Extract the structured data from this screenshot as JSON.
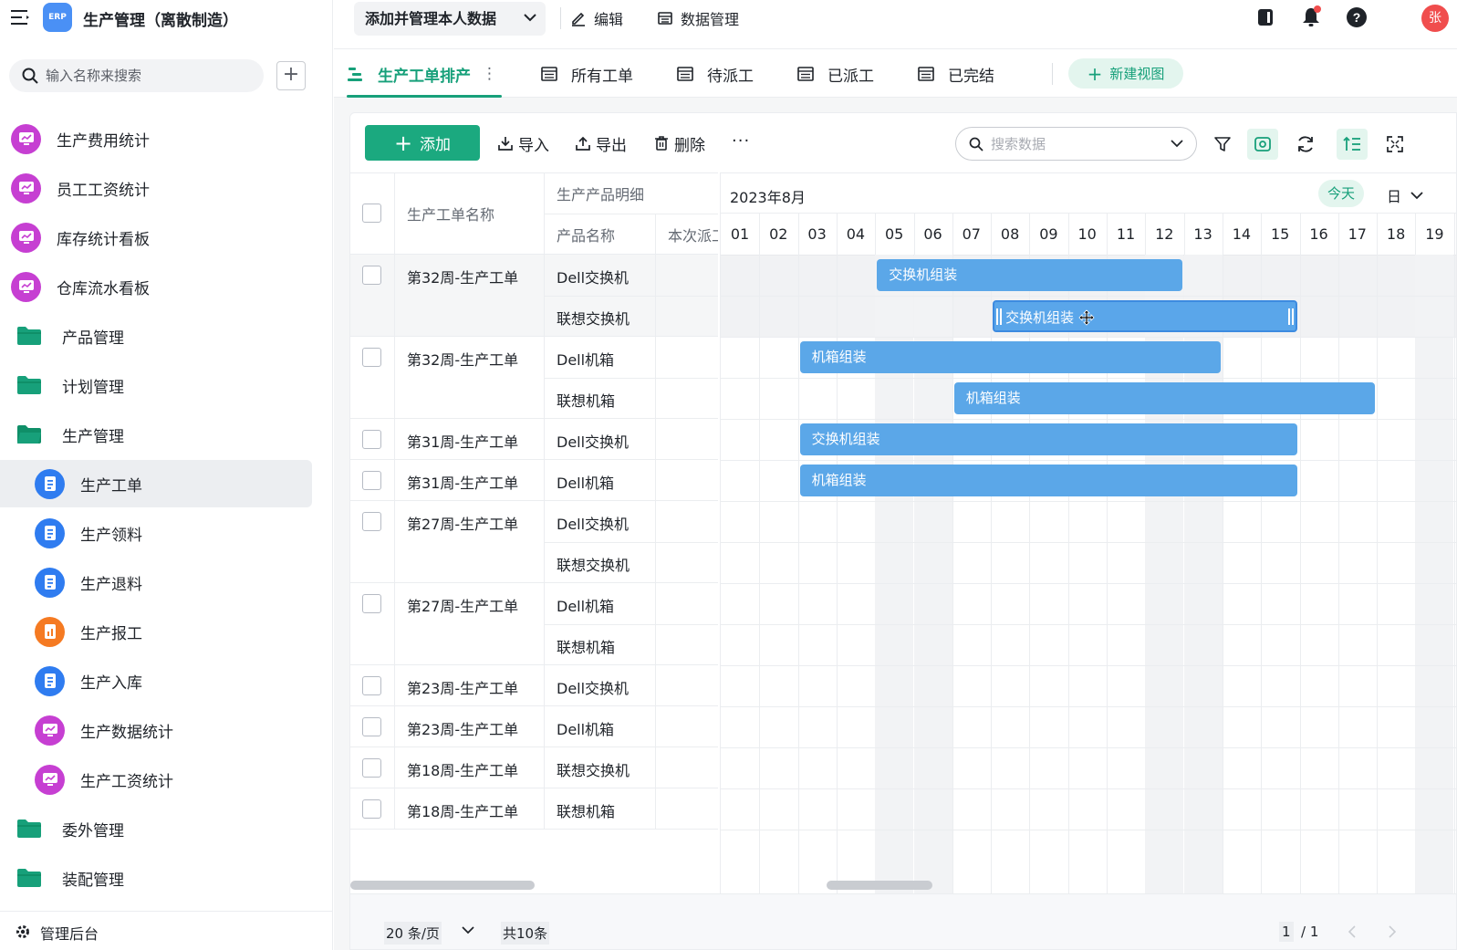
{
  "app": {
    "title": "生产管理（离散制造）",
    "logo_text": "ERP"
  },
  "sidebar": {
    "search_placeholder": "输入名称来搜索",
    "items": [
      {
        "label": "生产费用统计",
        "icon": "dashboard-icon",
        "level": 1
      },
      {
        "label": "员工工资统计",
        "icon": "dashboard-icon",
        "level": 1
      },
      {
        "label": "库存统计看板",
        "icon": "dashboard-icon",
        "level": 1
      },
      {
        "label": "仓库流水看板",
        "icon": "dashboard-icon",
        "level": 1
      },
      {
        "label": "产品管理",
        "icon": "folder-icon",
        "level": 1
      },
      {
        "label": "计划管理",
        "icon": "folder-icon",
        "level": 1
      },
      {
        "label": "生产管理",
        "icon": "folder-open-icon",
        "level": 1
      },
      {
        "label": "生产工单",
        "icon": "form-icon",
        "level": 2,
        "active": true
      },
      {
        "label": "生产领料",
        "icon": "form-icon",
        "level": 2
      },
      {
        "label": "生产退料",
        "icon": "form-icon",
        "level": 2
      },
      {
        "label": "生产报工",
        "icon": "report-icon",
        "level": 2
      },
      {
        "label": "生产入库",
        "icon": "form-icon",
        "level": 2
      },
      {
        "label": "生产数据统计",
        "icon": "dashboard-icon",
        "level": 2
      },
      {
        "label": "生产工资统计",
        "icon": "dashboard-icon",
        "level": 2
      },
      {
        "label": "委外管理",
        "icon": "folder-icon",
        "level": 1
      },
      {
        "label": "装配管理",
        "icon": "folder-icon",
        "level": 1
      }
    ],
    "footer_label": "管理后台"
  },
  "topbar": {
    "data_select": "添加并管理本人数据",
    "edit": "编辑",
    "data_manage": "数据管理",
    "avatar": "张"
  },
  "tabs": {
    "items": [
      "生产工单排产",
      "所有工单",
      "待派工",
      "已派工",
      "已完结"
    ],
    "active": 0,
    "new_view": "新建视图"
  },
  "toolbar": {
    "add": "添加",
    "import": "导入",
    "export": "导出",
    "delete": "删除",
    "more": "···",
    "search_placeholder": "搜索数据"
  },
  "table": {
    "columns": {
      "name": "生产工单名称",
      "detail_group": "生产产品明细",
      "product": "产品名称",
      "dispatch": "本次派工"
    },
    "rows": [
      {
        "name": "第32周-生产工单",
        "products": [
          "Dell交换机",
          "联想交换机"
        ]
      },
      {
        "name": "第32周-生产工单",
        "products": [
          "Dell机箱",
          "联想机箱"
        ]
      },
      {
        "name": "第31周-生产工单",
        "products": [
          "Dell交换机"
        ]
      },
      {
        "name": "第31周-生产工单",
        "products": [
          "Dell机箱"
        ]
      },
      {
        "name": "第27周-生产工单",
        "products": [
          "Dell交换机",
          "联想交换机"
        ]
      },
      {
        "name": "第27周-生产工单",
        "products": [
          "Dell机箱",
          "联想机箱"
        ]
      },
      {
        "name": "第23周-生产工单",
        "products": [
          "Dell交换机"
        ]
      },
      {
        "name": "第23周-生产工单",
        "products": [
          "Dell机箱"
        ]
      },
      {
        "name": "第18周-生产工单",
        "products": [
          "联想交换机"
        ]
      },
      {
        "name": "第18周-生产工单",
        "products": [
          "联想机箱"
        ]
      }
    ]
  },
  "gantt": {
    "month": "2023年8月",
    "today": "今天",
    "unit": "日",
    "days": [
      "01",
      "02",
      "03",
      "04",
      "05",
      "06",
      "07",
      "08",
      "09",
      "10",
      "11",
      "12",
      "13",
      "14",
      "15",
      "16",
      "17",
      "18",
      "19"
    ],
    "weekend_days": [
      5,
      6,
      12,
      13,
      19
    ],
    "bars": [
      {
        "label": "交换机组装",
        "start": 5,
        "end": 12,
        "row": 0
      },
      {
        "label": "交换机组装",
        "start": 8,
        "end": 15,
        "row": 1,
        "selected": true
      },
      {
        "label": "机箱组装",
        "start": 3,
        "end": 13,
        "row": 2
      },
      {
        "label": "机箱组装",
        "start": 7,
        "end": 17,
        "row": 3
      },
      {
        "label": "交换机组装",
        "start": 3,
        "end": 15,
        "row": 4
      },
      {
        "label": "机箱组装",
        "start": 3,
        "end": 15,
        "row": 5
      }
    ]
  },
  "pagination": {
    "page_size": "20 条/页",
    "total": "共10条",
    "current": "1",
    "of": "/ 1"
  },
  "colors": {
    "accent": "#1ba97f",
    "bar": "#5ba7e8",
    "dashboard": "#c63fd2",
    "form": "#2f7cf0",
    "report": "#f57a22",
    "folder": "#17a07a"
  }
}
